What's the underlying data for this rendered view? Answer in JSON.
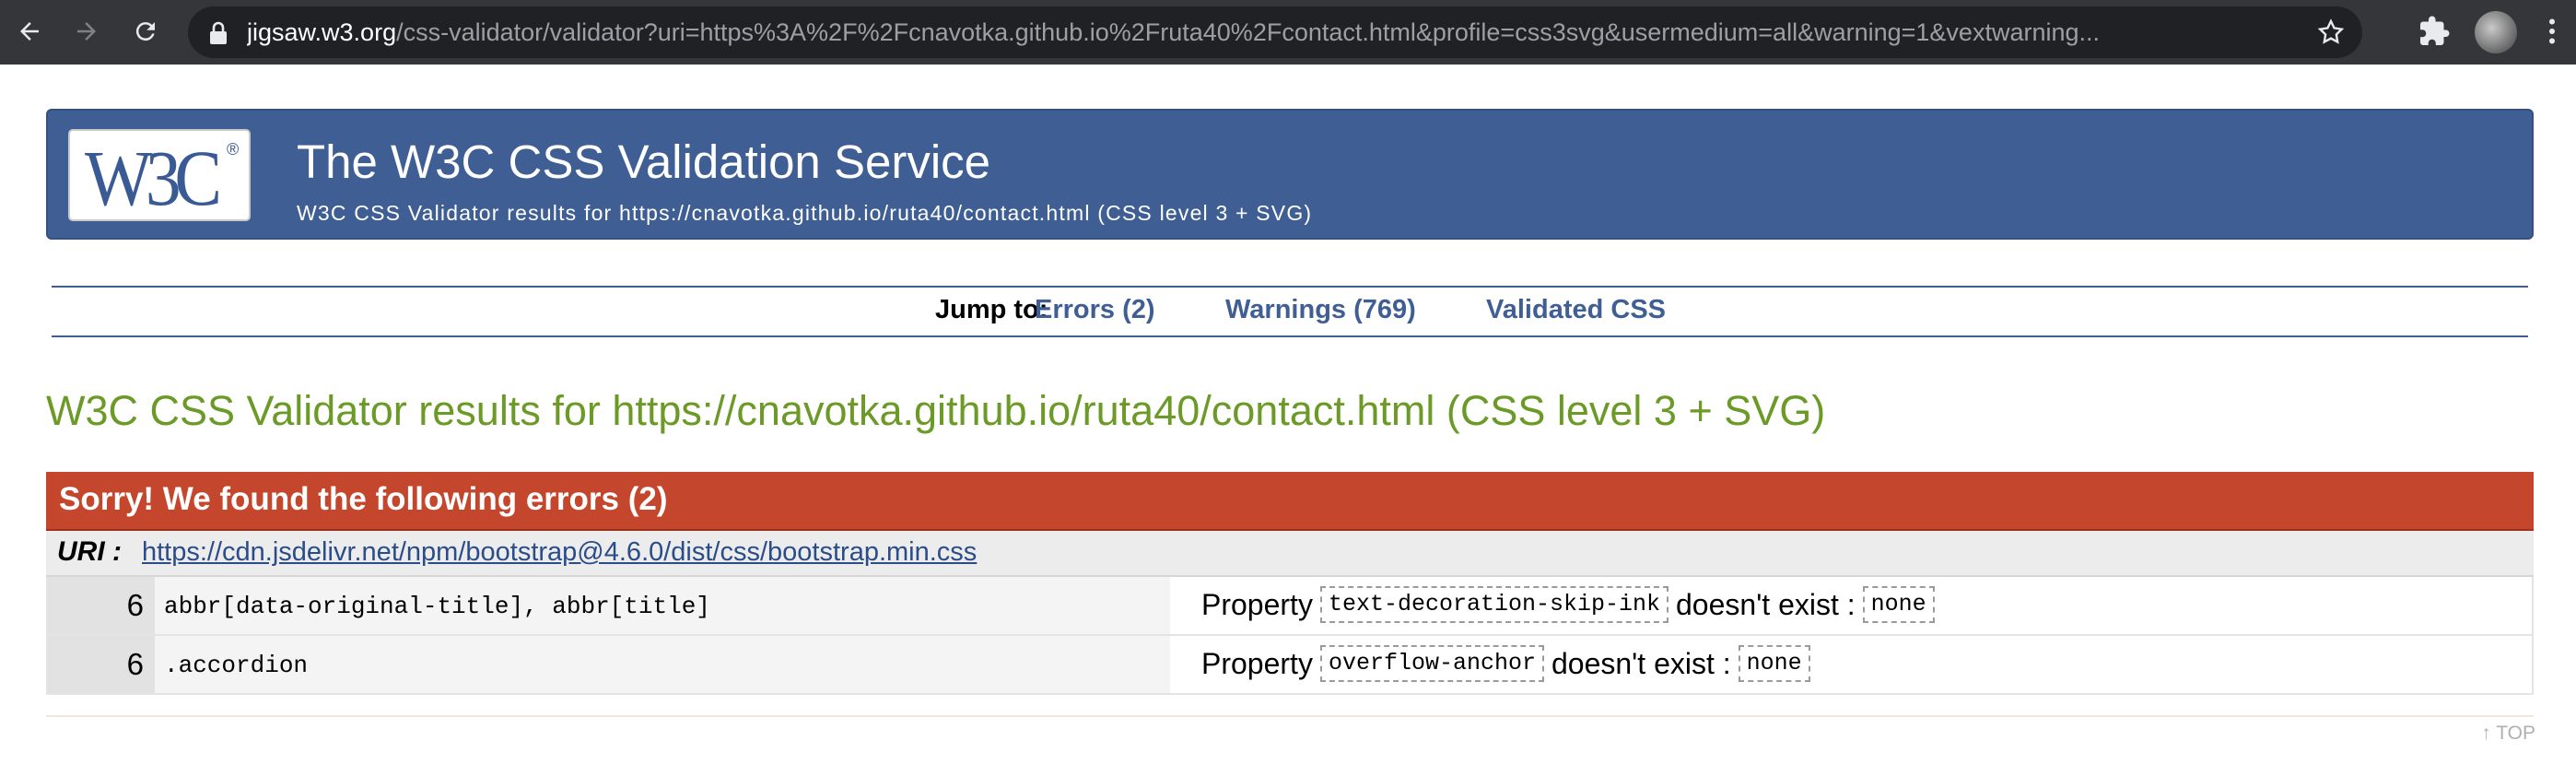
{
  "browser": {
    "url_host": "jigsaw.w3.org",
    "url_rest": "/css-validator/validator?uri=https%3A%2F%2Fcnavotka.github.io%2Fruta40%2Fcontact.html&profile=css3svg&usermedium=all&warning=1&vextwarning..."
  },
  "banner": {
    "logo_text": "W3C",
    "logo_reg": "®",
    "title": "The W3C CSS Validation Service",
    "subtitle": "W3C CSS Validator results for https://cnavotka.github.io/ruta40/contact.html (CSS level 3 + SVG)"
  },
  "jump": {
    "label": "Jump to:",
    "errors": "Errors (2)",
    "warnings": "Warnings (769)",
    "validated": "Validated CSS"
  },
  "results_heading": "W3C CSS Validator results for https://cnavotka.github.io/ruta40/contact.html (CSS level 3 + SVG)",
  "errors": {
    "header": "Sorry! We found the following errors (2)",
    "uri_label": "URI :",
    "uri": "https://cdn.jsdelivr.net/npm/bootstrap@4.6.0/dist/css/bootstrap.min.css",
    "rows": [
      {
        "line": "6",
        "context": "abbr[data-original-title], abbr[title]",
        "prefix": "Property",
        "property": "text-decoration-skip-ink",
        "middle": "doesn't exist :",
        "value": "none"
      },
      {
        "line": "6",
        "context": ".accordion",
        "prefix": "Property",
        "property": "overflow-anchor",
        "middle": "doesn't exist :",
        "value": "none"
      }
    ]
  },
  "top_link": "↑ TOP",
  "colors": {
    "banner": "#3f5f94",
    "heading_green": "#6b9a27",
    "error_red": "#c4472d",
    "link_blue": "#3f5f94"
  }
}
